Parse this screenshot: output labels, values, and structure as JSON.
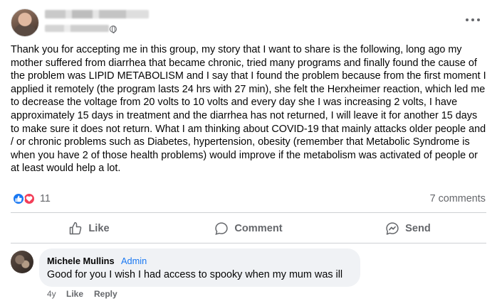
{
  "post": {
    "author": "",
    "body": "Thank you for accepting me in this group, my story that I want to share is the following, long ago my mother suffered from diarrhea that became chronic, tried many programs and finally found the cause of the problem was LIPID METABOLISM and I say that I found the problem because from the first moment I applied it remotely (the program lasts 24 hrs with 27 min), she felt the Herxheimer reaction, which led me to decrease the voltage from 20 volts to 10 volts and every day she I was increasing 2 volts, I have approximately 15 days in treatment and the diarrhea has not returned, I will leave it for another 15 days to make sure it does not return. What I am thinking about COVID-19 that mainly attacks older people and / or chronic problems such as Diabetes, hypertension, obesity (remember that Metabolic Syndrome is when you have 2 of those health problems) would improve if the metabolism was activated of people or at least would help a lot.",
    "reactions_count": "11",
    "comments_count": "7 comments"
  },
  "actions": {
    "like": "Like",
    "comment": "Comment",
    "send": "Send"
  },
  "comment": {
    "author": "Michele Mullins",
    "badge": "Admin",
    "text": "Good for you I wish I had access to spooky when my mum was ill",
    "time": "4y",
    "like": "Like",
    "reply": "Reply"
  },
  "colors": {
    "like_blue": "#1877f2",
    "love_red": "#f33e58",
    "secondary_text": "#65676b",
    "bubble_bg": "#f0f2f5"
  },
  "icons": [
    "globe-icon",
    "more-icon",
    "like-reaction-icon",
    "love-reaction-icon",
    "like-icon",
    "comment-icon",
    "send-icon"
  ]
}
